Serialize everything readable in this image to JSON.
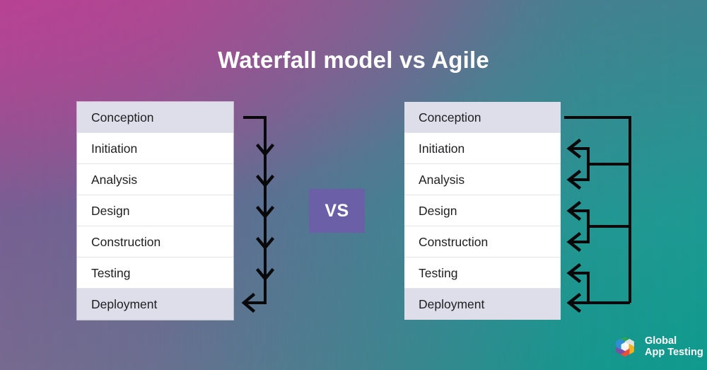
{
  "page": {
    "title": "Waterfall model vs Agile",
    "background": {
      "top_left": "#b14b90",
      "top_right": "#3d8490",
      "bottom_left": "#776a90",
      "bottom_right": "#0f9a8d"
    }
  },
  "vs_badge": {
    "label": "VS",
    "color": "#6b5fa8"
  },
  "waterfall": {
    "name": "Waterfall model",
    "phases": [
      {
        "label": "Conception",
        "highlighted": true
      },
      {
        "label": "Initiation",
        "highlighted": false
      },
      {
        "label": "Analysis",
        "highlighted": false
      },
      {
        "label": "Design",
        "highlighted": false
      },
      {
        "label": "Construction",
        "highlighted": false
      },
      {
        "label": "Testing",
        "highlighted": false
      },
      {
        "label": "Deployment",
        "highlighted": true
      }
    ],
    "flow_description": "Single one-way downward arrow from Conception to Deployment"
  },
  "agile": {
    "name": "Agile",
    "phases": [
      {
        "label": "Conception",
        "highlighted": true
      },
      {
        "label": "Initiation",
        "highlighted": false
      },
      {
        "label": "Analysis",
        "highlighted": false
      },
      {
        "label": "Design",
        "highlighted": false
      },
      {
        "label": "Construction",
        "highlighted": false
      },
      {
        "label": "Testing",
        "highlighted": false
      },
      {
        "label": "Deployment",
        "highlighted": true
      }
    ],
    "flow_description": "Iterative feedback loops returning from Conception to Initiation/Analysis, Design/Construction and Testing/Deployment"
  },
  "logo": {
    "line1": "Global",
    "line2": "App Testing",
    "mark_colors": [
      "#29a65a",
      "#d9dde0",
      "#f2b21b",
      "#e8503a",
      "#7b4fa3",
      "#2f8fd6"
    ]
  }
}
